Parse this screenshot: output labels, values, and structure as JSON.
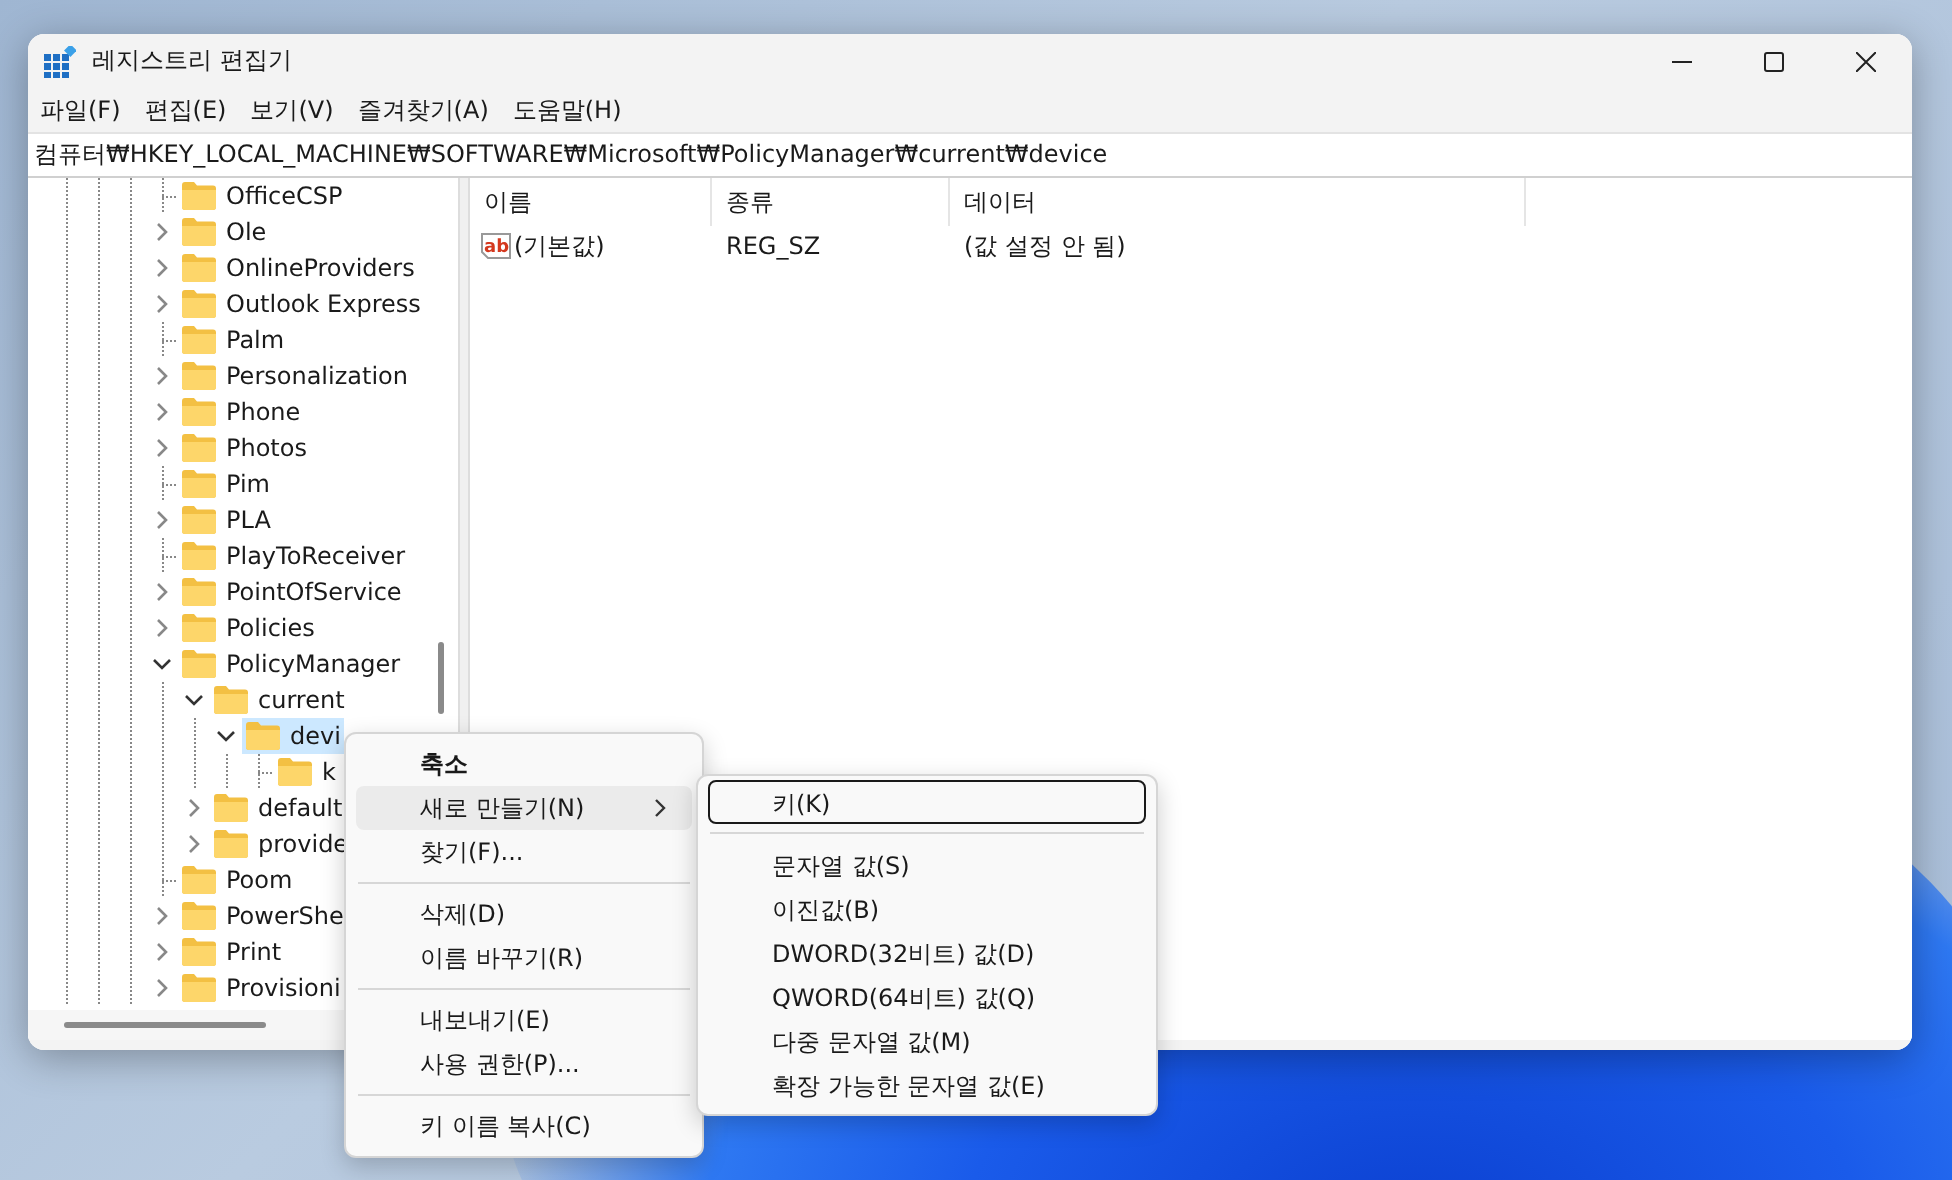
{
  "window": {
    "title": "레지스트리 편집기"
  },
  "menu_bar": [
    "파일(F)",
    "편집(E)",
    "보기(V)",
    "즐겨찾기(A)",
    "도움말(H)"
  ],
  "address_bar": {
    "value": "컴퓨터₩HKEY_LOCAL_MACHINE₩SOFTWARE₩Microsoft₩PolicyManager₩current₩device"
  },
  "tree": [
    {
      "label": "OfficeCSP",
      "expandable": false,
      "selected": false
    },
    {
      "label": "Ole",
      "expandable": true,
      "expanded": false,
      "selected": false
    },
    {
      "label": "OnlineProviders",
      "expandable": true,
      "expanded": false,
      "selected": false
    },
    {
      "label": "Outlook Express",
      "expandable": true,
      "expanded": false,
      "selected": false
    },
    {
      "label": "Palm",
      "expandable": false,
      "selected": false
    },
    {
      "label": "Personalization",
      "expandable": true,
      "expanded": false,
      "selected": false
    },
    {
      "label": "Phone",
      "expandable": true,
      "expanded": false,
      "selected": false
    },
    {
      "label": "Photos",
      "expandable": true,
      "expanded": false,
      "selected": false
    },
    {
      "label": "Pim",
      "expandable": false,
      "selected": false
    },
    {
      "label": "PLA",
      "expandable": true,
      "expanded": false,
      "selected": false
    },
    {
      "label": "PlayToReceiver",
      "expandable": false,
      "selected": false
    },
    {
      "label": "PointOfService",
      "expandable": true,
      "expanded": false,
      "selected": false
    },
    {
      "label": "Policies",
      "expandable": true,
      "expanded": false,
      "selected": false
    },
    {
      "label": "PolicyManager",
      "expandable": true,
      "expanded": true,
      "selected": false,
      "children": [
        {
          "label": "current",
          "expandable": true,
          "expanded": true,
          "selected": false,
          "children": [
            {
              "label": "devi",
              "expandable": true,
              "expanded": true,
              "selected": true,
              "children": [
                {
                  "label": "k",
                  "expandable": false,
                  "selected": false
                }
              ]
            }
          ]
        },
        {
          "label": "default",
          "expandable": true,
          "expanded": false,
          "selected": false
        },
        {
          "label": "provide",
          "expandable": true,
          "expanded": false,
          "selected": false
        }
      ]
    },
    {
      "label": "Poom",
      "expandable": false,
      "selected": false
    },
    {
      "label": "PowerShe",
      "expandable": true,
      "expanded": false,
      "selected": false
    },
    {
      "label": "Print",
      "expandable": true,
      "expanded": false,
      "selected": false
    },
    {
      "label": "Provisioni",
      "expandable": true,
      "expanded": false,
      "selected": false
    }
  ],
  "list_view": {
    "columns": [
      "이름",
      "종류",
      "데이터"
    ],
    "rows": [
      {
        "icon_label": "ab",
        "name": "(기본값)",
        "type": "REG_SZ",
        "data": "(값 설정 안 됨)"
      }
    ]
  },
  "context_menu": {
    "items": [
      {
        "kind": "item",
        "label": "축소",
        "default": true,
        "highlighted": false,
        "submenu": false
      },
      {
        "kind": "item",
        "label": "새로 만들기(N)",
        "default": false,
        "highlighted": true,
        "submenu": true
      },
      {
        "kind": "item",
        "label": "찾기(F)...",
        "default": false,
        "highlighted": false,
        "submenu": false
      },
      {
        "kind": "separator"
      },
      {
        "kind": "item",
        "label": "삭제(D)",
        "default": false,
        "highlighted": false,
        "submenu": false
      },
      {
        "kind": "item",
        "label": "이름 바꾸기(R)",
        "default": false,
        "highlighted": false,
        "submenu": false
      },
      {
        "kind": "separator"
      },
      {
        "kind": "item",
        "label": "내보내기(E)",
        "default": false,
        "highlighted": false,
        "submenu": false
      },
      {
        "kind": "item",
        "label": "사용 권한(P)...",
        "default": false,
        "highlighted": false,
        "submenu": false
      },
      {
        "kind": "separator"
      },
      {
        "kind": "item",
        "label": "키 이름 복사(C)",
        "default": false,
        "highlighted": false,
        "submenu": false
      }
    ]
  },
  "submenu": {
    "items": [
      {
        "kind": "item",
        "label": "키(K)",
        "focused": true
      },
      {
        "kind": "separator"
      },
      {
        "kind": "item",
        "label": "문자열 값(S)",
        "focused": false
      },
      {
        "kind": "item",
        "label": "이진값(B)",
        "focused": false
      },
      {
        "kind": "item",
        "label": "DWORD(32비트) 값(D)",
        "focused": false
      },
      {
        "kind": "item",
        "label": "QWORD(64비트) 값(Q)",
        "focused": false
      },
      {
        "kind": "item",
        "label": "다중 문자열 값(M)",
        "focused": false
      },
      {
        "kind": "item",
        "label": "확장 가능한 문자열 값(E)",
        "focused": false
      }
    ]
  }
}
